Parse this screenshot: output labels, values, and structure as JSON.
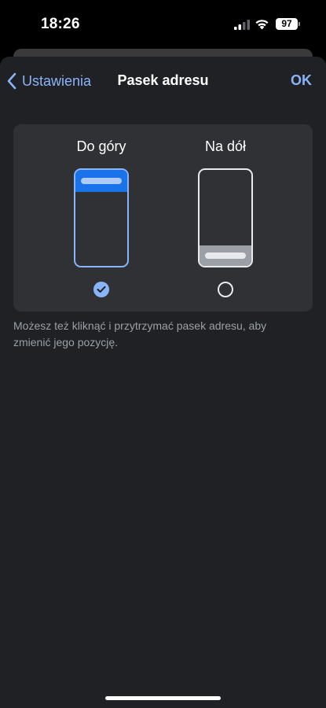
{
  "status_bar": {
    "time": "18:26",
    "battery": "97",
    "icons": [
      "signal-icon",
      "wifi-icon",
      "battery-icon"
    ]
  },
  "nav": {
    "back_label": "Ustawienia",
    "title": "Pasek adresu",
    "done_label": "OK"
  },
  "options": [
    {
      "label": "Do góry",
      "selected": true,
      "bar_position": "top"
    },
    {
      "label": "Na dół",
      "selected": false,
      "bar_position": "bottom"
    }
  ],
  "hint": "Możesz też kliknąć i przytrzymać pasek adresu, aby zmienić jego pozycję.",
  "colors": {
    "background": "#202124",
    "card": "#303134",
    "accent": "#8ab4f8",
    "accent_strong": "#1a73e8",
    "secondary_text": "#9aa0a6"
  }
}
